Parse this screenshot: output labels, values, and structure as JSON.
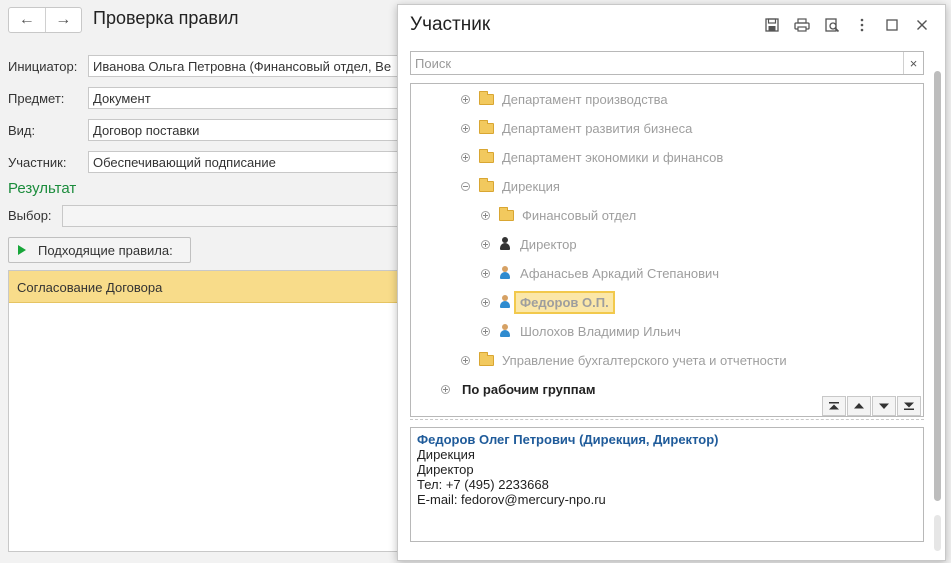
{
  "form": {
    "title": "Проверка правил",
    "nav": {
      "back": "←",
      "forward": "→"
    },
    "fields": [
      {
        "label": "Инициатор:",
        "value": "Иванова Ольга Петровна (Финансовый отдел, Ве"
      },
      {
        "label": "Предмет:",
        "value": "Документ"
      },
      {
        "label": "Вид:",
        "value": "Договор поставки"
      },
      {
        "label": "Участник:",
        "value": "Обеспечивающий подписание"
      }
    ],
    "result_title": "Результат",
    "choice_label": "Выбор:",
    "choice_value": "",
    "rules_button": "Подходящие правила:",
    "rules": [
      "Согласование Договора"
    ]
  },
  "dialog": {
    "title": "Участник",
    "tools": [
      "save-icon",
      "print-icon",
      "preview-icon",
      "more-icon",
      "maximize-icon",
      "close-icon"
    ],
    "search": {
      "placeholder": "Поиск",
      "value": "",
      "clear": "×"
    },
    "tree": [
      {
        "label": "Департамент производства",
        "icon": "folder",
        "expander": "plus",
        "level": 2
      },
      {
        "label": "Департамент развития бизнеса",
        "icon": "folder",
        "expander": "plus",
        "level": 2
      },
      {
        "label": "Департамент экономики и финансов",
        "icon": "folder",
        "expander": "plus",
        "level": 2
      },
      {
        "label": "Дирекция",
        "icon": "folder",
        "expander": "minus",
        "level": 2
      },
      {
        "label": "Финансовый отдел",
        "icon": "folder",
        "expander": "plus",
        "level": 3
      },
      {
        "label": "Директор",
        "icon": "person-dark",
        "expander": "plus",
        "level": 3
      },
      {
        "label": "Афанасьев Аркадий Степанович",
        "icon": "person",
        "expander": "plus",
        "level": 3
      },
      {
        "label": "Федоров О.П.",
        "icon": "person",
        "expander": "plus",
        "level": 3,
        "selected": true
      },
      {
        "label": "Шолохов Владимир Ильич",
        "icon": "person",
        "expander": "plus",
        "level": 3
      },
      {
        "label": "Управление бухгалтерского учета и отчетности",
        "icon": "folder",
        "expander": "plus",
        "level": 2
      },
      {
        "label": "По рабочим группам",
        "icon": "none",
        "expander": "plus",
        "level": 1,
        "bold": true
      }
    ],
    "tree_nav": [
      "first-icon",
      "up-icon",
      "down-icon",
      "last-icon"
    ],
    "info": {
      "name": "Федоров Олег Петрович (Дирекция, Директор)",
      "department": "Дирекция",
      "position": "Директор",
      "phone": "Тел: +7 (495) 2233668",
      "email": "E-mail: fedorov@mercury-npo.ru"
    }
  }
}
